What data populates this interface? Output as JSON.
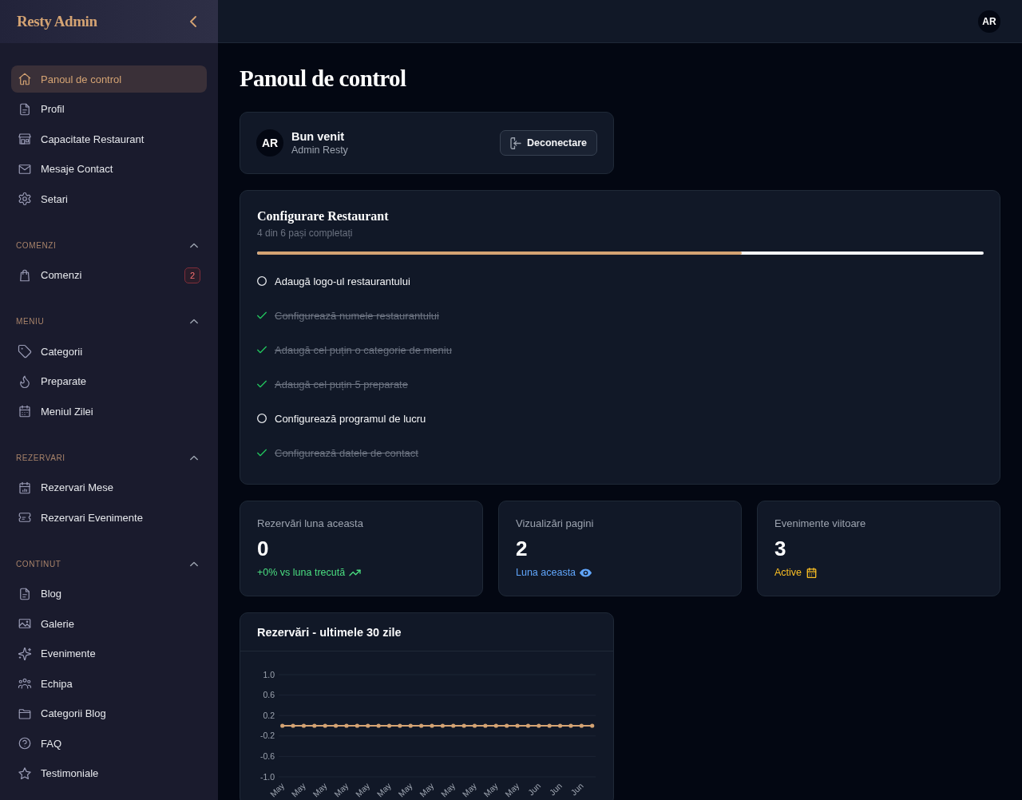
{
  "sidebar": {
    "logo": "Resty Admin",
    "items": [
      {
        "label": "Panoul de control",
        "selected": true
      },
      {
        "label": "Profil",
        "selected": false
      },
      {
        "label": "Capacitate Restaurant",
        "selected": false
      },
      {
        "label": "Mesaje Contact",
        "selected": false
      },
      {
        "label": "Setari",
        "selected": false
      }
    ],
    "sections": [
      {
        "title": "COMENZI",
        "expanded": true,
        "items": [
          {
            "label": "Comenzi",
            "selected": false,
            "badge": "2"
          }
        ]
      },
      {
        "title": "MENIU",
        "expanded": true,
        "items": [
          {
            "label": "Categorii",
            "selected": false
          },
          {
            "label": "Preparate",
            "selected": false
          },
          {
            "label": "Meniul Zilei",
            "selected": false
          }
        ]
      },
      {
        "title": "REZERVARI",
        "expanded": true,
        "items": [
          {
            "label": "Rezervari Mese",
            "selected": false
          },
          {
            "label": "Rezervari Evenimente",
            "selected": false
          }
        ]
      },
      {
        "title": "CONTINUT",
        "expanded": true,
        "items": [
          {
            "label": "Blog",
            "selected": false
          },
          {
            "label": "Galerie",
            "selected": false
          },
          {
            "label": "Evenimente",
            "selected": false
          },
          {
            "label": "Echipa",
            "selected": false
          },
          {
            "label": "Categorii Blog",
            "selected": false
          },
          {
            "label": "FAQ",
            "selected": false
          },
          {
            "label": "Testimoniale",
            "selected": false
          }
        ]
      }
    ]
  },
  "top_bar": {
    "avatar": "AR"
  },
  "page_title": "Panoul de control",
  "welcome_card": {
    "avatar": "AR",
    "greeting": "Bun venit",
    "name": "Admin Resty",
    "button": "Deconectare"
  },
  "setup_card": {
    "title": "Configurare Restaurant",
    "subtitle": "4 din 6 pași completați",
    "progress": {
      "level": 0.667
    },
    "steps": [
      {
        "label": "Adaugă logo-ul restaurantului",
        "done": false
      },
      {
        "label": "Configurează numele restaurantului",
        "done": true
      },
      {
        "label": "Adaugă cel puțin o categorie de meniu",
        "done": true
      },
      {
        "label": "Adaugă cel puțin 5 preparate",
        "done": true
      },
      {
        "label": "Configurează programul de lucru",
        "done": false
      },
      {
        "label": "Configurează datele de contact",
        "done": true
      }
    ]
  },
  "stats": [
    {
      "label": "Rezervări luna aceasta",
      "value": "0",
      "note": "+0% vs luna trecută",
      "color": "#4ade80"
    },
    {
      "label": "Vizualizări pagini",
      "value": "2",
      "note": "Luna aceasta",
      "color": "#60a5fa"
    },
    {
      "label": "Evenimente viitoare",
      "value": "3",
      "note": "Active",
      "color": "#fbbf24"
    }
  ],
  "chart_card": {
    "title": "Rezervări - ultimele 30 zile",
    "chart_data": {
      "type": "line",
      "categories": [
        "May",
        null,
        "May",
        null,
        "May",
        null,
        "May",
        null,
        "May",
        null,
        "May",
        null,
        "May",
        null,
        "May",
        null,
        "May",
        null,
        "May",
        null,
        "May",
        null,
        "May",
        null,
        "Jun",
        null,
        "Jun",
        null,
        "Jun",
        null
      ],
      "series": [
        {
          "color": "#d4a373",
          "values": [
            0,
            0,
            0,
            0,
            0,
            0,
            0,
            0,
            0,
            0,
            0,
            0,
            0,
            0,
            0,
            0,
            0,
            0,
            0,
            0,
            0,
            0,
            0,
            0,
            0,
            0,
            0,
            0,
            0,
            0
          ]
        }
      ],
      "ylim": [
        -1,
        1
      ],
      "yticks": [
        {
          "value": 1,
          "label": "1.0"
        },
        {
          "value": 0.6,
          "label": "0.6"
        },
        {
          "value": 0.2,
          "label": "0.2"
        },
        {
          "value": -0.2,
          "label": "-0.2"
        },
        {
          "value": -0.6,
          "label": "-0.6"
        },
        {
          "value": -1,
          "label": "-1.0"
        }
      ],
      "grid": true
    }
  }
}
